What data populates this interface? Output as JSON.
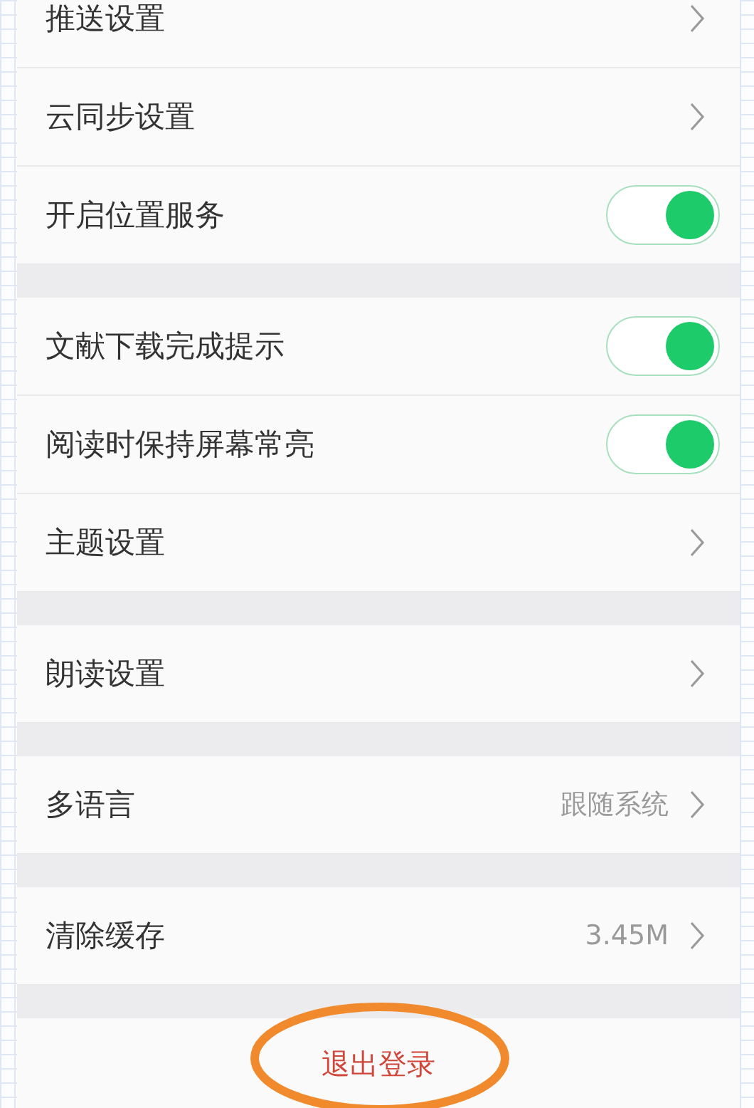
{
  "sections": [
    {
      "rows": [
        {
          "kind": "link",
          "label": "推送设置"
        },
        {
          "kind": "link",
          "label": "云同步设置"
        },
        {
          "kind": "toggle",
          "label": "开启位置服务",
          "on": true
        }
      ]
    },
    {
      "rows": [
        {
          "kind": "toggle",
          "label": "文献下载完成提示",
          "on": true
        },
        {
          "kind": "toggle",
          "label": "阅读时保持屏幕常亮",
          "on": true
        },
        {
          "kind": "link",
          "label": "主题设置"
        }
      ]
    },
    {
      "rows": [
        {
          "kind": "link",
          "label": "朗读设置"
        }
      ]
    },
    {
      "rows": [
        {
          "kind": "link",
          "label": "多语言",
          "value": "跟随系统"
        }
      ]
    },
    {
      "rows": [
        {
          "kind": "link",
          "label": "清除缓存",
          "value": "3.45M"
        }
      ]
    }
  ],
  "logout": {
    "label": "退出登录",
    "circled": true
  }
}
